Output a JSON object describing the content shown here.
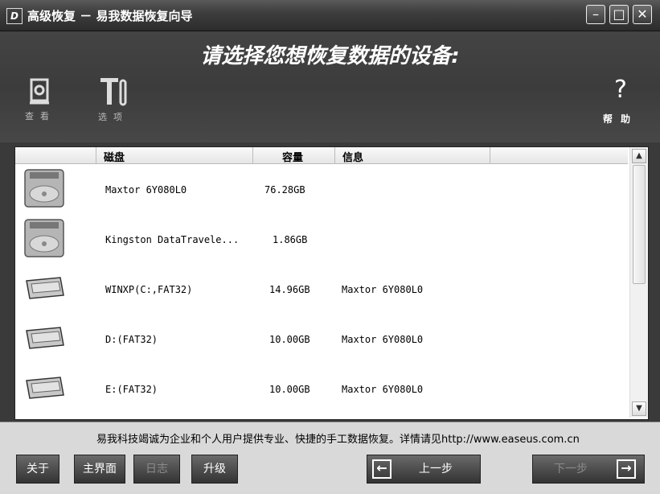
{
  "window": {
    "logo_glyph": "D",
    "title": "高级恢复 － 易我数据恢复向导",
    "minimize": "–",
    "maximize": "□",
    "close": "✕"
  },
  "header": {
    "title": "请选择您想恢复数据的设备:",
    "toolbar": {
      "view_label": "查看",
      "options_label": "选项",
      "help_label": "帮助",
      "help_glyph": "?"
    }
  },
  "table": {
    "columns": [
      "磁盘",
      "容量",
      "信息"
    ],
    "rows": [
      {
        "icon": "hard-disk-icon",
        "name": "Maxtor 6Y080L0",
        "capacity": "76.28GB",
        "info": ""
      },
      {
        "icon": "hard-disk-icon",
        "name": "Kingston DataTravele...",
        "capacity": "1.86GB",
        "info": ""
      },
      {
        "icon": "partition-icon",
        "name": "WINXP(C:,FAT32)",
        "capacity": "14.96GB",
        "info": "Maxtor 6Y080L0"
      },
      {
        "icon": "partition-icon",
        "name": "D:(FAT32)",
        "capacity": "10.00GB",
        "info": "Maxtor 6Y080L0"
      },
      {
        "icon": "partition-icon",
        "name": "E:(FAT32)",
        "capacity": "10.00GB",
        "info": "Maxtor 6Y080L0"
      }
    ]
  },
  "footer": {
    "notice": "易我科技竭诚为企业和个人用户提供专业、快捷的手工数据恢复。详情请见http://www.easeus.com.cn",
    "buttons": {
      "about": "关于",
      "main": "主界面",
      "log": "日志",
      "upgrade": "升级",
      "prev": "上一步",
      "next": "下一步"
    }
  }
}
